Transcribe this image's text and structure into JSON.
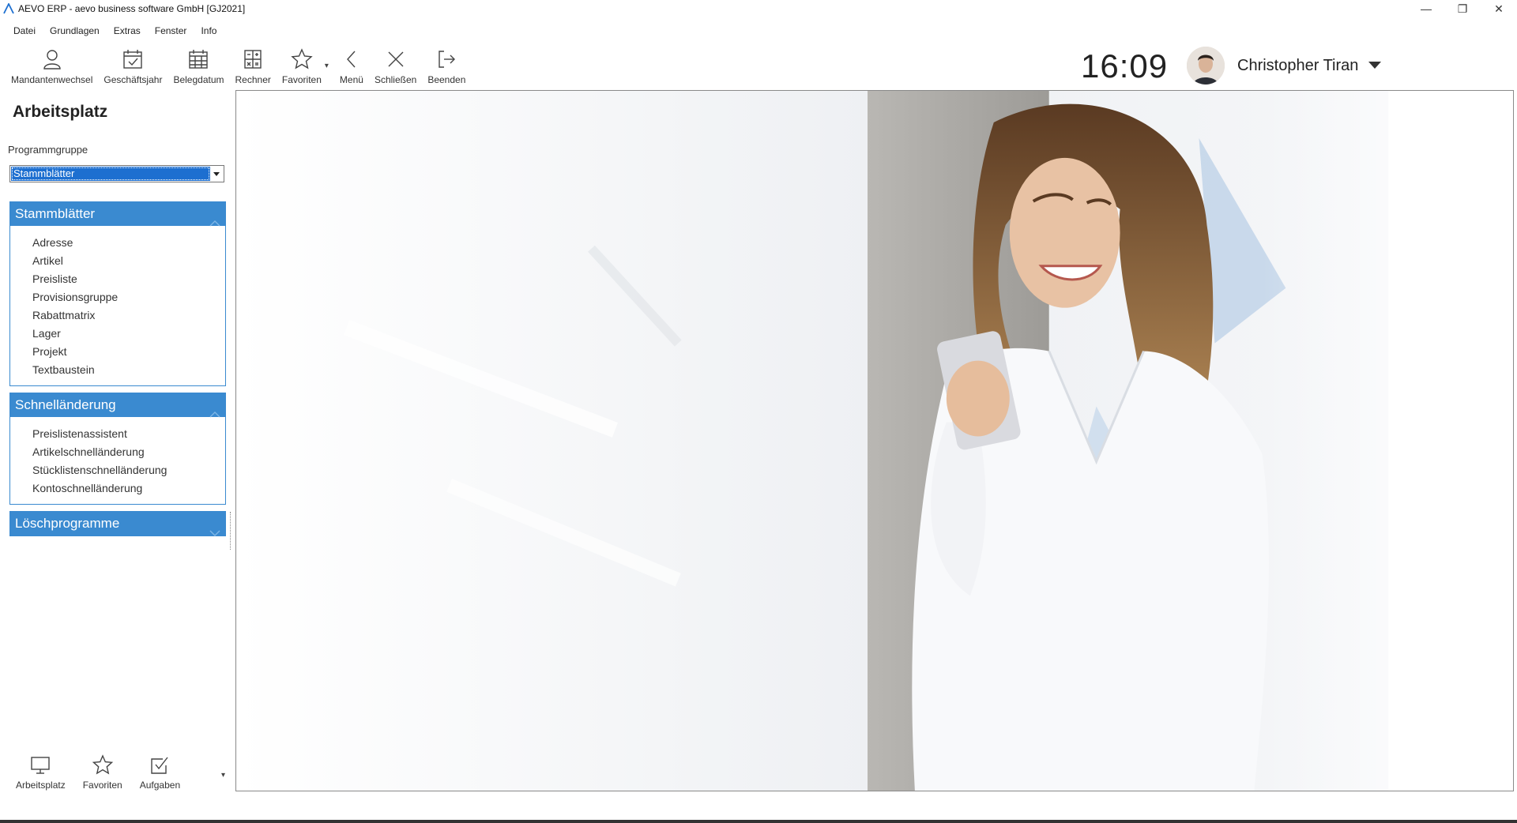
{
  "window": {
    "title": "AEVO ERP - aevo business software GmbH [GJ2021]",
    "controls": {
      "minimize": "—",
      "restore": "❐",
      "close": "✕"
    }
  },
  "menu": [
    "Datei",
    "Grundlagen",
    "Extras",
    "Fenster",
    "Info"
  ],
  "toolbar": {
    "mandantenwechsel": "Mandantenwechsel",
    "geschaeftsjahr": "Geschäftsjahr",
    "belegdatum": "Belegdatum",
    "rechner": "Rechner",
    "favoriten": "Favoriten",
    "menue": "Menü",
    "schliessen": "Schließen",
    "beenden": "Beenden"
  },
  "clock": "16:09",
  "user": {
    "name": "Christopher Tiran"
  },
  "sidebar": {
    "title": "Arbeitsplatz",
    "group_label": "Programmgruppe",
    "group_value": "Stammblätter",
    "sections": [
      {
        "title": "Stammblätter",
        "expanded": true,
        "items": [
          "Adresse",
          "Artikel",
          "Preisliste",
          "Provisionsgruppe",
          "Rabattmatrix",
          "Lager",
          "Projekt",
          "Textbaustein"
        ]
      },
      {
        "title": "Schnelländerung",
        "expanded": true,
        "items": [
          "Preislistenassistent",
          "Artikelschnelländerung",
          "Stücklistenschnelländerung",
          "Kontoschnelländerung"
        ]
      },
      {
        "title": "Löschprogramme",
        "expanded": false,
        "items": []
      }
    ]
  },
  "bottom_nav": {
    "arbeitsplatz": "Arbeitsplatz",
    "favoriten": "Favoriten",
    "aufgaben": "Aufgaben"
  },
  "colors": {
    "accent": "#3a8ad0",
    "selection": "#1d6fd0"
  },
  "icons": {
    "mandantenwechsel": "user-icon",
    "geschaeftsjahr": "calendar-check-icon",
    "belegdatum": "calendar-grid-icon",
    "rechner": "calculator-icon",
    "favoriten": "star-icon",
    "menue": "chevron-left-icon",
    "schliessen": "close-icon",
    "beenden": "exit-icon"
  }
}
